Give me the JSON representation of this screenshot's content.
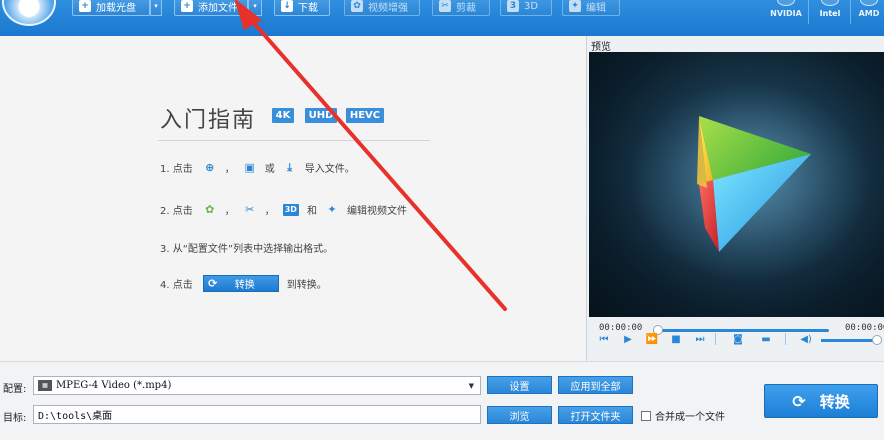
{
  "toolbar": {
    "add_disc": "加载光盘",
    "add_file": "添加文件",
    "download": "下载",
    "video_enhance": "视频增强",
    "clip": "剪裁",
    "three_d": "3D",
    "edit": "编辑",
    "hw_nvidia": "NVIDIA",
    "hw_intel": "Intel",
    "hw_amd": "AMD"
  },
  "guide": {
    "title": "入门指南",
    "badges": [
      "4K",
      "UHD",
      "HEVC"
    ],
    "step1": {
      "num": "1. 点击",
      "sep1": "，",
      "or": "或",
      "text": "导入文件。"
    },
    "step2": {
      "num": "2. 点击",
      "sep1": "，",
      "sep2": "，",
      "and": "和",
      "text": "编辑视频文件"
    },
    "step3": {
      "text": "3. 从“配置文件”列表中选择输出格式。"
    },
    "step4": {
      "num": "4. 点击",
      "button": "转换",
      "text": "到转换。"
    }
  },
  "preview": {
    "label": "预览",
    "time_current": "00:00:00",
    "time_total": "00:00:00",
    "progress": 0,
    "volume": 1
  },
  "bottom": {
    "profile_label": "配置:",
    "profile_value": "MPEG-4 Video (*.mp4)",
    "target_label": "目标:",
    "target_value": "D:\\tools\\桌面",
    "settings": "设置",
    "apply_all": "应用到全部",
    "browse": "浏览",
    "open_folder": "打开文件夹",
    "merge": "合并成一个文件",
    "convert": "转换"
  },
  "colors": {
    "accent": "#2a86d8",
    "arrow": "#e8312a"
  }
}
